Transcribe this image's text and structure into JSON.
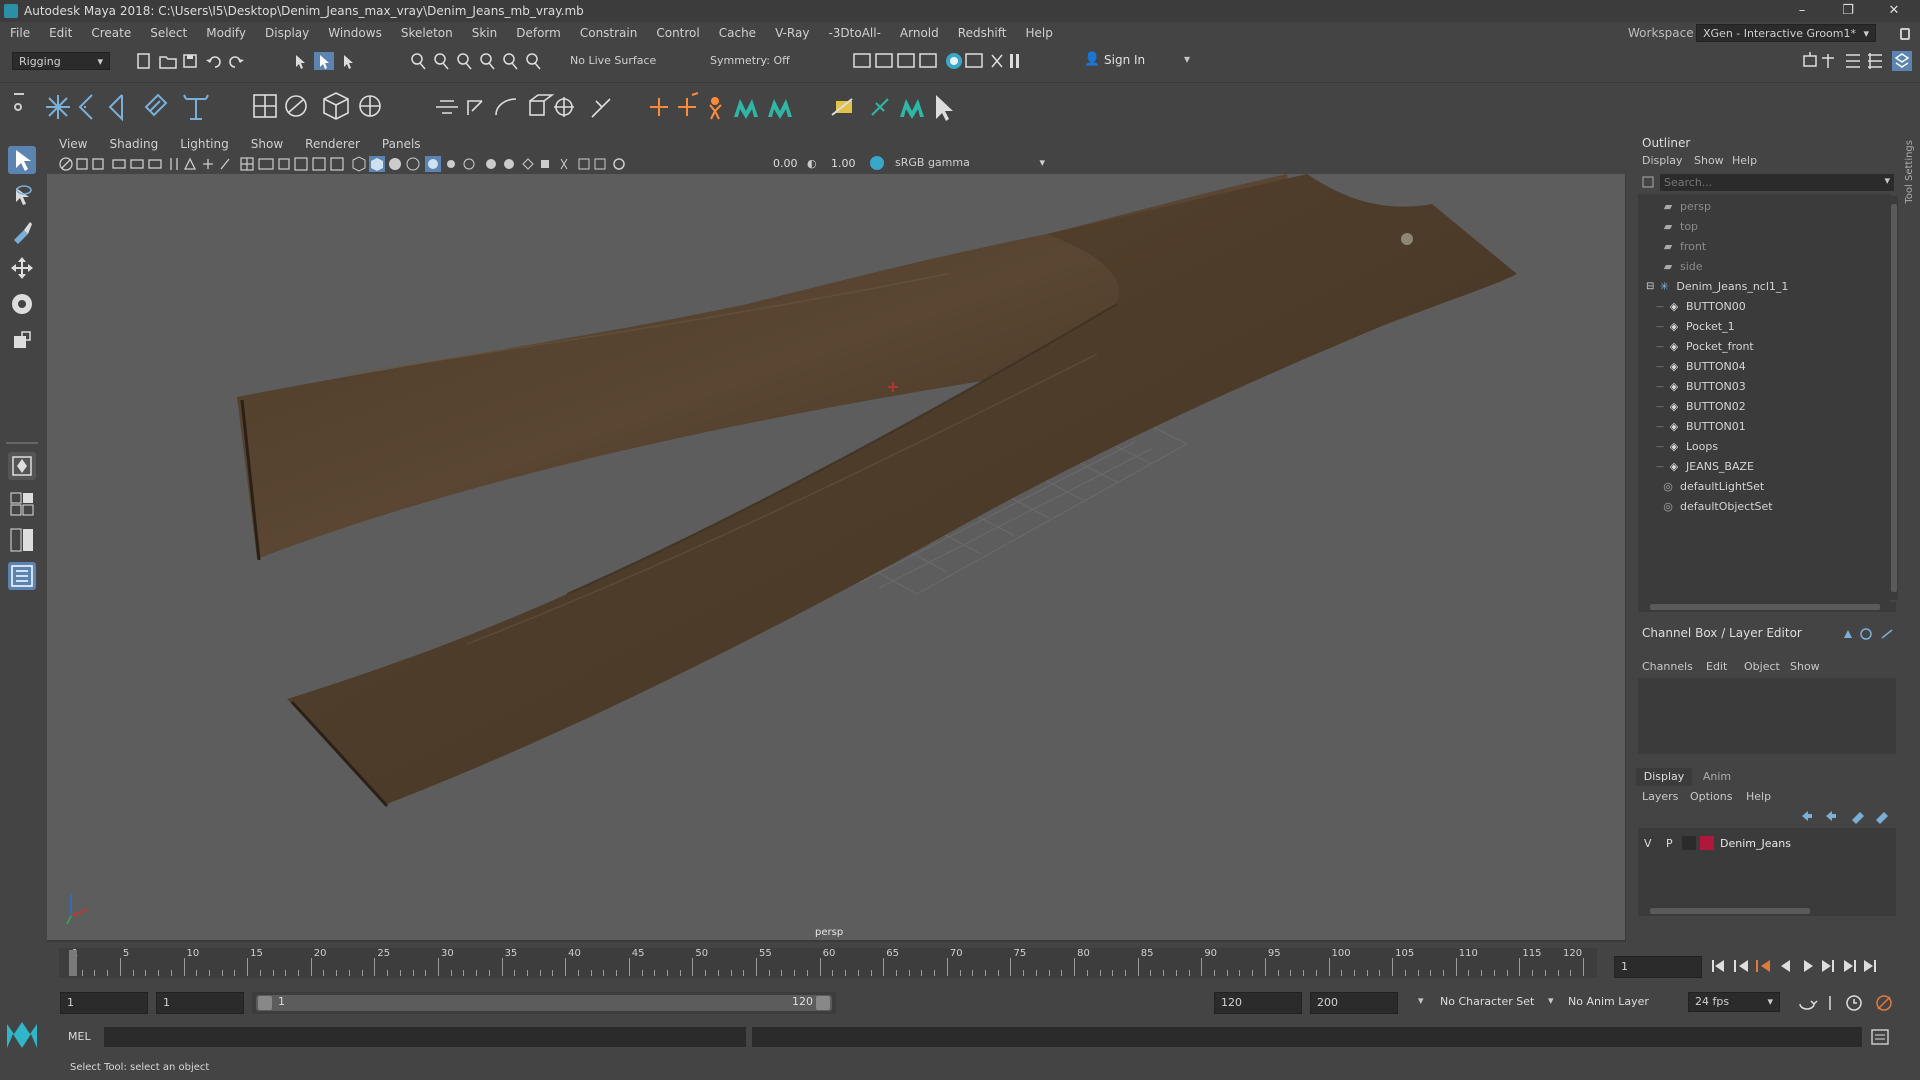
{
  "window": {
    "title": "Autodesk Maya 2018: C:\\Users\\I5\\Desktop\\Denim_Jeans_max_vray\\Denim_Jeans_mb_vray.mb",
    "controls": [
      "–",
      "❐",
      "✕"
    ]
  },
  "menubar": {
    "items": [
      "File",
      "Edit",
      "Create",
      "Select",
      "Modify",
      "Display",
      "Windows",
      "Skeleton",
      "Skin",
      "Deform",
      "Constrain",
      "Control",
      "Cache",
      "V-Ray",
      "-3DtoAll-",
      "Arnold",
      "Redshift",
      "Help"
    ],
    "workspace_label": "Workspace :",
    "workspace_value": "XGen - Interactive Groom1*"
  },
  "statusline": {
    "menuset": "Rigging",
    "live_surface": "No Live Surface",
    "symmetry": "Symmetry: Off",
    "sign_in": "Sign In"
  },
  "viewport": {
    "menus": [
      "View",
      "Shading",
      "Lighting",
      "Show",
      "Renderer",
      "Panels"
    ],
    "exposure": "0.00",
    "gamma": "1.00",
    "color_space": "sRGB gamma",
    "camera_label": "persp"
  },
  "outliner": {
    "title": "Outliner",
    "menus": [
      "Display",
      "Show",
      "Help"
    ],
    "search_placeholder": "Search...",
    "items": [
      {
        "label": "persp",
        "kind": "camera",
        "indent": 0,
        "dim": true
      },
      {
        "label": "top",
        "kind": "camera",
        "indent": 0,
        "dim": true
      },
      {
        "label": "front",
        "kind": "camera",
        "indent": 0,
        "dim": true
      },
      {
        "label": "side",
        "kind": "camera",
        "indent": 0,
        "dim": true
      },
      {
        "label": "Denim_Jeans_ncl1_1",
        "kind": "group",
        "indent": 0,
        "dim": false
      },
      {
        "label": "BUTTON00",
        "kind": "mesh",
        "indent": 1,
        "dim": false
      },
      {
        "label": "Pocket_1",
        "kind": "mesh",
        "indent": 1,
        "dim": false
      },
      {
        "label": "Pocket_front",
        "kind": "mesh",
        "indent": 1,
        "dim": false
      },
      {
        "label": "BUTTON04",
        "kind": "mesh",
        "indent": 1,
        "dim": false
      },
      {
        "label": "BUTTON03",
        "kind": "mesh",
        "indent": 1,
        "dim": false
      },
      {
        "label": "BUTTON02",
        "kind": "mesh",
        "indent": 1,
        "dim": false
      },
      {
        "label": "BUTTON01",
        "kind": "mesh",
        "indent": 1,
        "dim": false
      },
      {
        "label": "Loops",
        "kind": "mesh",
        "indent": 1,
        "dim": false
      },
      {
        "label": "JEANS_BAZE",
        "kind": "mesh",
        "indent": 1,
        "dim": false
      },
      {
        "label": "defaultLightSet",
        "kind": "set",
        "indent": 0,
        "dim": false
      },
      {
        "label": "defaultObjectSet",
        "kind": "set",
        "indent": 0,
        "dim": false
      }
    ]
  },
  "channelbox": {
    "title": "Channel Box / Layer Editor",
    "menus": [
      "Channels",
      "Edit",
      "Object",
      "Show"
    ]
  },
  "layers": {
    "tabs": [
      "Display",
      "Anim"
    ],
    "menus": [
      "Layers",
      "Options",
      "Help"
    ],
    "layer": {
      "v": "V",
      "p": "P",
      "name": "Denim_Jeans",
      "color": "#b0173a"
    }
  },
  "timeline": {
    "ticks": [
      "1",
      "5",
      "10",
      "15",
      "20",
      "25",
      "30",
      "35",
      "40",
      "45",
      "50",
      "55",
      "60",
      "65",
      "70",
      "75",
      "80",
      "85",
      "90",
      "95",
      "100",
      "105",
      "110",
      "115",
      "120"
    ],
    "current_frame": "1"
  },
  "range": {
    "start": "1",
    "playback_start": "1",
    "slider_start": "1",
    "slider_end": "120",
    "playback_end": "120",
    "end": "200",
    "character_set": "No Character Set",
    "anim_layer": "No Anim Layer",
    "fps": "24 fps"
  },
  "commandline": {
    "label": "MEL"
  },
  "helpline": {
    "text": "Select Tool: select an object"
  },
  "side_tab": "Tool Settings"
}
